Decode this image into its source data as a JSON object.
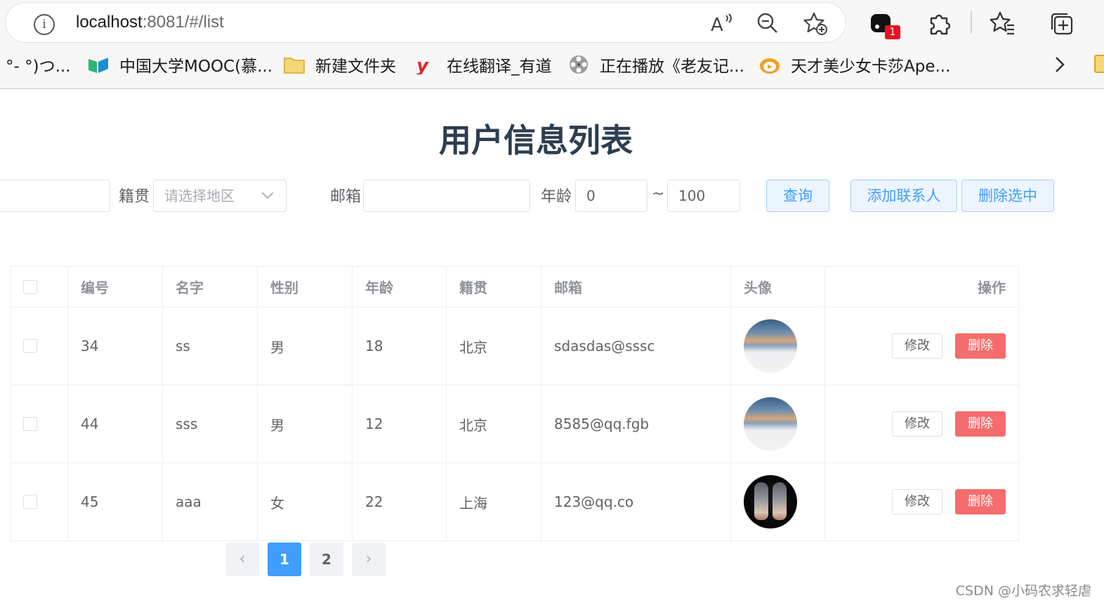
{
  "browser": {
    "url_host": "localhost",
    "url_rest": ":8081/#/list",
    "info_icon_glyph": "i",
    "tab_count_badge": "1",
    "bookmarks": [
      {
        "label": "°- °)つ...",
        "icon": "none"
      },
      {
        "label": "中国大学MOOC(慕...",
        "icon": "mooc-icon"
      },
      {
        "label": "新建文件夹",
        "icon": "folder-icon"
      },
      {
        "label": "在线翻译_有道",
        "icon": "youdao-icon"
      },
      {
        "label": "正在播放《老友记...",
        "icon": "film-reel-icon"
      },
      {
        "label": "天才美少女卡莎Ape...",
        "icon": "bilibili-icon"
      }
    ]
  },
  "page": {
    "title": "用户信息列表",
    "filters": {
      "origin_label": "籍贯",
      "origin_placeholder": "请选择地区",
      "email_label": "邮箱",
      "email_value": "",
      "age_label": "年龄",
      "age_min": "0",
      "age_sep": "~",
      "age_max": "100",
      "query_button": "查询",
      "add_button": "添加联系人",
      "delete_selected_button": "删除选中"
    },
    "table": {
      "headers": [
        "编号",
        "名字",
        "性别",
        "年龄",
        "籍贯",
        "邮箱",
        "头像",
        "操作"
      ],
      "rows": [
        {
          "id": "34",
          "name": "ss",
          "gender": "男",
          "age": "18",
          "origin": "北京",
          "email": "sdasdas@sssc",
          "avatar": "sky"
        },
        {
          "id": "44",
          "name": "sss",
          "gender": "男",
          "age": "12",
          "origin": "北京",
          "email": "8585@qq.fgb",
          "avatar": "sky"
        },
        {
          "id": "45",
          "name": "aaa",
          "gender": "女",
          "age": "22",
          "origin": "上海",
          "email": "123@qq.co",
          "avatar": "shoes"
        }
      ],
      "edit_label": "修改",
      "delete_label": "删除"
    },
    "pagination": {
      "prev": "‹",
      "pages": [
        "1",
        "2"
      ],
      "current": "1",
      "next": "›"
    },
    "watermark": "CSDN @小码农求轻虐"
  },
  "colors": {
    "primary": "#409eff",
    "danger": "#f56c6c",
    "title": "#2c3e50"
  }
}
